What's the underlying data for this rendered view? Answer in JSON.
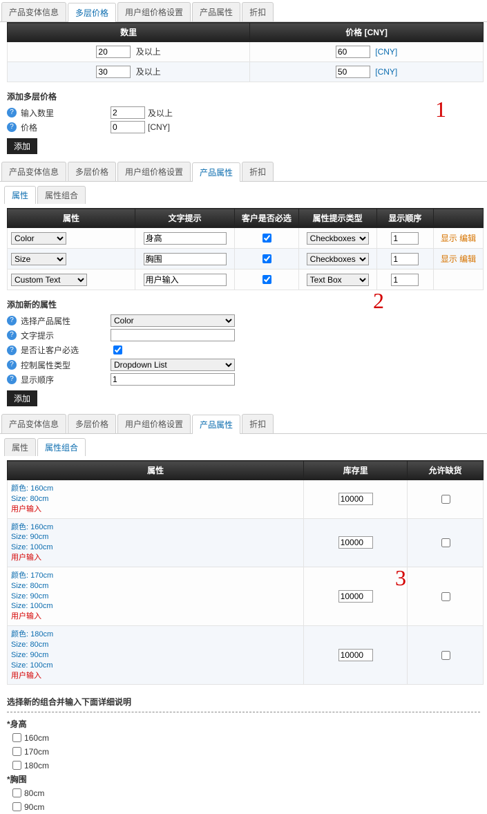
{
  "annotations": {
    "one": "1",
    "two": "2",
    "three": "3"
  },
  "section1": {
    "tabs": [
      "产品变体信息",
      "多层价格",
      "用户组价格设置",
      "产品属性",
      "折扣"
    ],
    "activeTab": 1,
    "table": {
      "headers": [
        "数里",
        "价格 [CNY]"
      ],
      "suffix": "及以上",
      "currency": "[CNY]",
      "rows": [
        {
          "qty": "20",
          "price": "60"
        },
        {
          "qty": "30",
          "price": "50"
        }
      ]
    },
    "addTitle": "添加多层价格",
    "form": {
      "qtyLabel": "输入数里",
      "qtyValue": "2",
      "qtySuffix": "及以上",
      "priceLabel": "价格",
      "priceValue": "0",
      "priceSuffix": "[CNY]",
      "addBtn": "添加"
    }
  },
  "section2": {
    "tabs": [
      "产品变体信息",
      "多层价格",
      "用户组价格设置",
      "产品属性",
      "折扣"
    ],
    "activeTab": 3,
    "subtabs": [
      "属性",
      "属性组合"
    ],
    "activeSubtab": 0,
    "table": {
      "headers": [
        "属性",
        "文字提示",
        "客户是否必选",
        "属性提示类型",
        "显示顺序",
        ""
      ],
      "rows": [
        {
          "attr": "Color",
          "hint": "身高",
          "req": true,
          "type": "Checkboxes",
          "order": "1",
          "action": "显示 编辑"
        },
        {
          "attr": "Size",
          "hint": "胸围",
          "req": true,
          "type": "Checkboxes",
          "order": "1",
          "action": "显示 编辑"
        },
        {
          "attr": "Custom Text",
          "hint": "用户输入",
          "req": true,
          "type": "Text Box",
          "order": "1",
          "action": ""
        }
      ]
    },
    "addTitle": "添加新的属性",
    "form": {
      "attrLabel": "选择产品属性",
      "attrValue": "Color",
      "hintLabel": "文字提示",
      "hintValue": "",
      "reqLabel": "是否让客户必选",
      "reqValue": true,
      "typeLabel": "控制属性类型",
      "typeValue": "Dropdown List",
      "orderLabel": "显示顺序",
      "orderValue": "1",
      "addBtn": "添加"
    }
  },
  "section3": {
    "tabs": [
      "产品变体信息",
      "多层价格",
      "用户组价格设置",
      "产品属性",
      "折扣"
    ],
    "activeTab": 3,
    "subtabs": [
      "属性",
      "属性组合"
    ],
    "activeSubtab": 1,
    "table": {
      "headers": [
        "属性",
        "库存里",
        "允许缺货"
      ],
      "rows": [
        {
          "lines": [
            "颜色: 160cm",
            "Size: 80cm",
            "用户输入"
          ],
          "stock": "10000",
          "back": false
        },
        {
          "lines": [
            "颜色: 160cm",
            "Size: 90cm",
            "Size: 100cm",
            "用户输入"
          ],
          "stock": "10000",
          "back": false
        },
        {
          "lines": [
            "颜色: 170cm",
            "Size: 80cm",
            "Size: 90cm",
            "Size: 100cm",
            "用户输入"
          ],
          "stock": "10000",
          "back": false
        },
        {
          "lines": [
            "颜色: 180cm",
            "Size: 80cm",
            "Size: 90cm",
            "Size: 100cm",
            "用户输入"
          ],
          "stock": "10000",
          "back": false
        }
      ]
    },
    "comboPrompt": "选择新的组合并输入下面详细说明",
    "group1": {
      "title": "身高",
      "opts": [
        "160cm",
        "170cm",
        "180cm"
      ]
    },
    "group2": {
      "title": "胸围",
      "opts": [
        "80cm",
        "90cm"
      ]
    }
  }
}
